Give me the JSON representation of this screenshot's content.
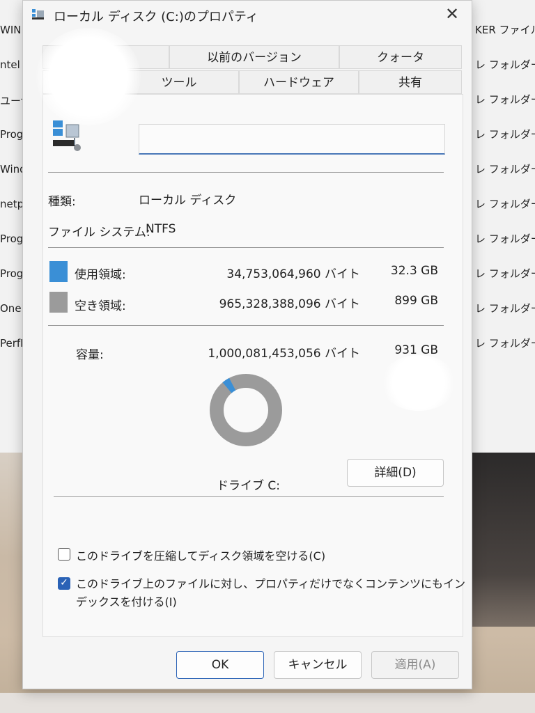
{
  "background": {
    "left_items": [
      "WIN",
      "ntel",
      "ユーザ",
      "Prog",
      "Wind",
      "netp",
      "Prog",
      "Prog",
      "OneI",
      "PerfL"
    ],
    "right_items": [
      "KER ファイル",
      "レ フォルダー",
      "レ フォルダー",
      "レ フォルダー",
      "レ フォルダー",
      "レ フォルダー",
      "レ フォルダー",
      "レ フォルダー",
      "レ フォルダー",
      "レ フォルダー"
    ]
  },
  "dialog": {
    "title": "ローカル ディスク (C:)のプロパティ",
    "close_glyph": "✕",
    "tabs_top": [
      "",
      "以前のバージョン",
      "クォータ"
    ],
    "tabs_bottom": [
      "",
      "ツール",
      "ハードウェア",
      "共有"
    ],
    "name_value": "",
    "type_label": "種類:",
    "type_value": "ローカル ディスク",
    "fs_label": "ファイル システム:",
    "fs_value": "NTFS",
    "used": {
      "label": "使用領域:",
      "bytes": "34,753,064,960 バイト",
      "size": "32.3 GB"
    },
    "free": {
      "label": "空き領域:",
      "bytes": "965,328,388,096 バイト",
      "size": "899 GB"
    },
    "capacity": {
      "label": "容量:",
      "bytes": "1,000,081,453,056 バイト",
      "size": "931 GB"
    },
    "drive_label": "ドライブ C:",
    "details_button": "詳細(D)",
    "compress_label": "このドライブを圧縮してディスク領域を空ける(C)",
    "compress_checked": false,
    "index_label_line1": "このドライブ上のファイルに対し、プロパティだけでなくコンテンツにもイン",
    "index_label_line2": "デックスを付ける(I)",
    "index_checked": true,
    "ok_button": "OK",
    "cancel_button": "キャンセル",
    "apply_button": "適用(A)"
  },
  "chart_data": {
    "type": "pie",
    "categories": [
      "使用領域",
      "空き領域"
    ],
    "values": [
      34753064960,
      965328388096
    ]
  },
  "colors": {
    "used": "#3a8fd6",
    "free": "#9b9b9b",
    "accent": "#2a62b6"
  }
}
